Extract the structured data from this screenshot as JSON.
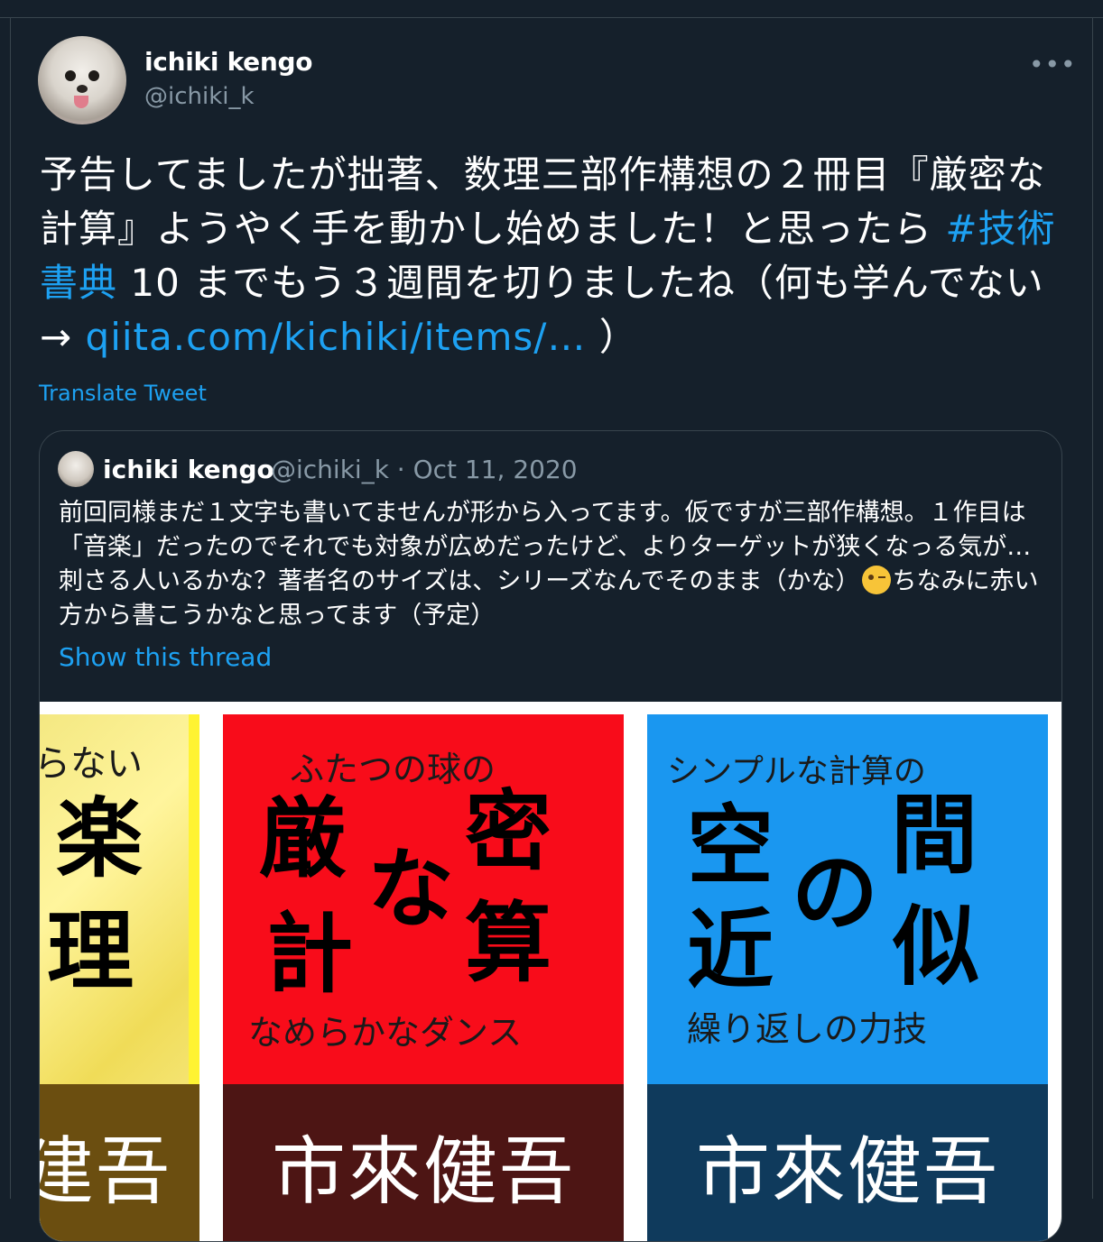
{
  "tweet": {
    "author_name": "ichiki kengo",
    "author_handle": "@ichiki_k",
    "more_label": "•••",
    "text_part1": "予告してましたが拙著、数理三部作構想の２冊目『厳密な計算』ようやく手を動かし始めました！と思ったら ",
    "hashtag": "#技術書典",
    "text_part2": " 10 までもう３週間を切りましたね（何も学んでない→ ",
    "link": "qiita.com/kichiki/items/…",
    "text_part3": " ）",
    "translate_label": "Translate Tweet"
  },
  "quote": {
    "author_name": "ichiki kengo",
    "meta": "@ichiki_k · Oct 11, 2020",
    "text_before_emoji": "前回同様まだ１文字も書いてませんが形から入ってます。仮ですが三部作構想。１作目は「音楽」だったのでそれでも対象が広めだったけど、よりターゲットが狭くなっる気が…刺さる人いるかな？著者名のサイズは、シリーズなんでそのまま（かな）",
    "emoji": "winking-face",
    "text_after_emoji": "ちなみに赤い方から書こうかなと思ってます（予定）",
    "show_thread_label": "Show this thread"
  },
  "covers": {
    "yellow": {
      "subtitle": "らない",
      "title_chars": [
        "楽",
        "理"
      ],
      "author": "建吾",
      "color": "#fff332"
    },
    "red": {
      "subtitle": "ふたつの球の",
      "title_chars": [
        "厳",
        "密",
        "な",
        "計",
        "算"
      ],
      "tagline": "なめらかなダンス",
      "author": "市來健吾",
      "color": "#f80c1a"
    },
    "blue": {
      "subtitle": "シンプルな計算の",
      "title_chars": [
        "空",
        "間",
        "の",
        "近",
        "似"
      ],
      "tagline": "繰り返しの力技",
      "author": "市來健吾",
      "color": "#1a97f0"
    }
  }
}
